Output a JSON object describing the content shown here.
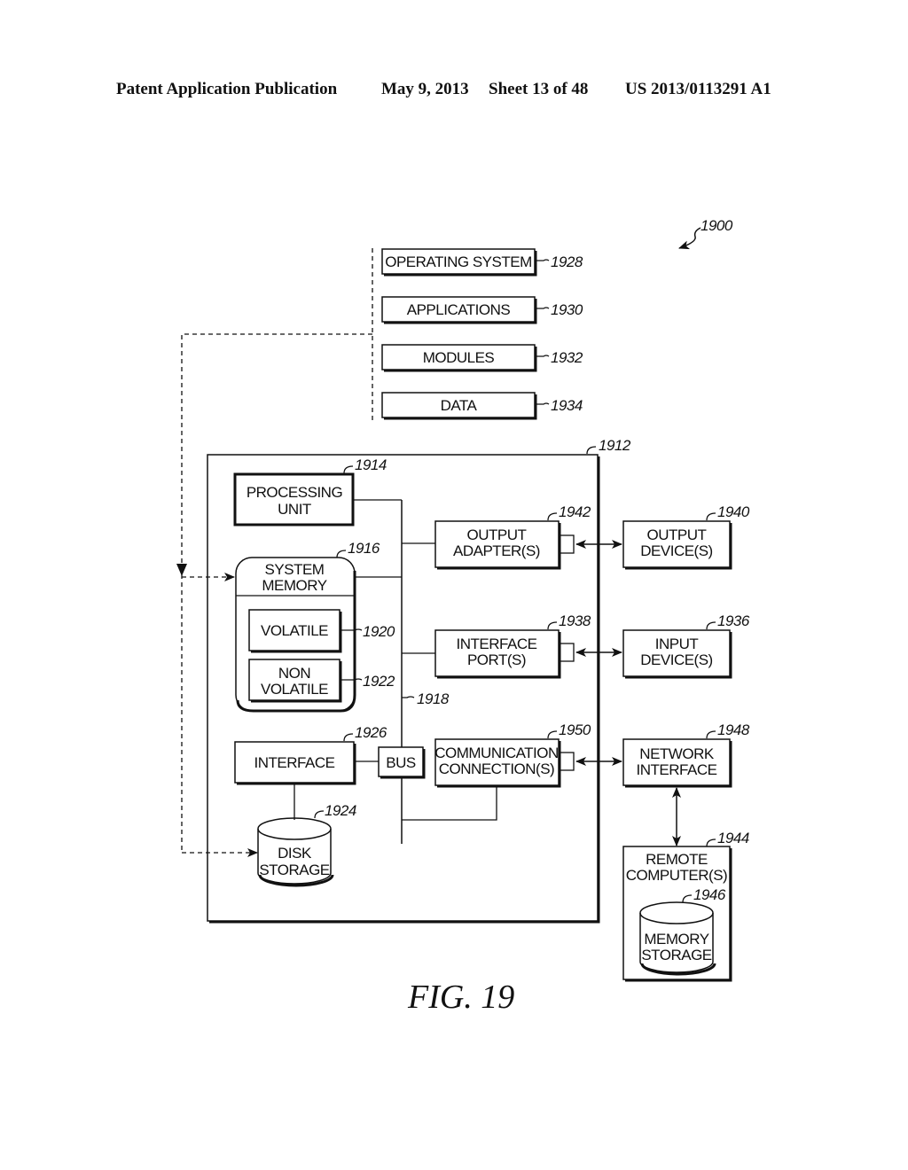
{
  "header": {
    "publication": "Patent Application Publication",
    "date": "May 9, 2013",
    "sheet": "Sheet 13 of 48",
    "number": "US 2013/0113291 A1"
  },
  "figure": {
    "caption": "FIG. 19",
    "system_ref": "1900",
    "computer_ref": "1912",
    "bus_ref": "1918",
    "software": [
      {
        "label": "OPERATING SYSTEM",
        "ref": "1928"
      },
      {
        "label": "APPLICATIONS",
        "ref": "1930"
      },
      {
        "label": "MODULES",
        "ref": "1932"
      },
      {
        "label": "DATA",
        "ref": "1934"
      }
    ],
    "processing_unit": {
      "line1": "PROCESSING",
      "line2": "UNIT",
      "ref": "1914"
    },
    "system_memory": {
      "line1": "SYSTEM",
      "line2": "MEMORY",
      "ref": "1916"
    },
    "volatile": {
      "label": "VOLATILE",
      "ref": "1920"
    },
    "non_volatile": {
      "line1": "NON",
      "line2": "VOLATILE",
      "ref": "1922"
    },
    "interface": {
      "label": "INTERFACE",
      "ref": "1926"
    },
    "bus": {
      "label": "BUS"
    },
    "disk_storage": {
      "line1": "DISK",
      "line2": "STORAGE",
      "ref": "1924"
    },
    "output_adapter": {
      "line1": "OUTPUT",
      "line2": "ADAPTER(S)",
      "ref": "1942"
    },
    "interface_port": {
      "line1": "INTERFACE",
      "line2": "PORT(S)",
      "ref": "1938"
    },
    "comm_connection": {
      "line1": "COMMUNICATION",
      "line2": "CONNECTION(S)",
      "ref": "1950"
    },
    "output_device": {
      "line1": "OUTPUT",
      "line2": "DEVICE(S)",
      "ref": "1940"
    },
    "input_device": {
      "line1": "INPUT",
      "line2": "DEVICE(S)",
      "ref": "1936"
    },
    "network_interface": {
      "line1": "NETWORK",
      "line2": "INTERFACE",
      "ref": "1948"
    },
    "remote_computer": {
      "line1": "REMOTE",
      "line2": "COMPUTER(S)",
      "ref": "1944"
    },
    "memory_storage": {
      "line1": "MEMORY",
      "line2": "STORAGE",
      "ref": "1946"
    }
  }
}
